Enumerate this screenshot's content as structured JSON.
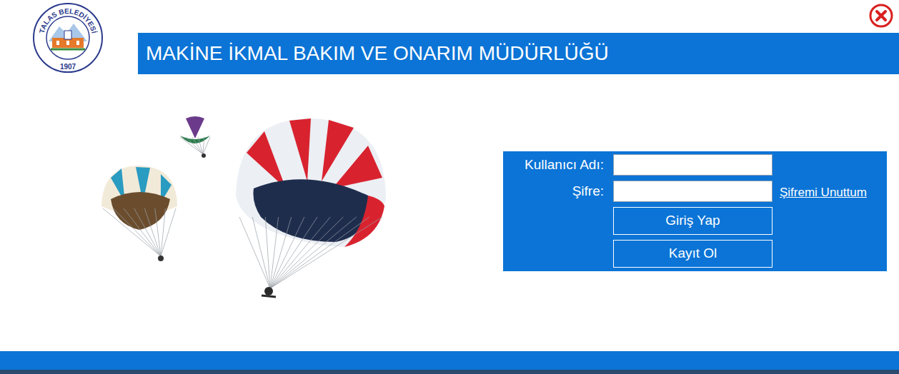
{
  "logo": {
    "arc_text": "TALAS BELEDİYESİ",
    "year": "1907"
  },
  "header": {
    "title": "MAKİNE İKMAL BAKIM VE ONARIM MÜDÜRLÜĞÜ"
  },
  "login_form": {
    "fields": [
      {
        "label": "Kullanıcı Adı:",
        "value": "",
        "kind": "text"
      },
      {
        "label": "Şifre:",
        "value": "",
        "kind": "password"
      }
    ],
    "forgot_link": "Şifremi Unuttum",
    "buttons": [
      "Giriş Yap",
      "Kayıt Ol"
    ]
  }
}
